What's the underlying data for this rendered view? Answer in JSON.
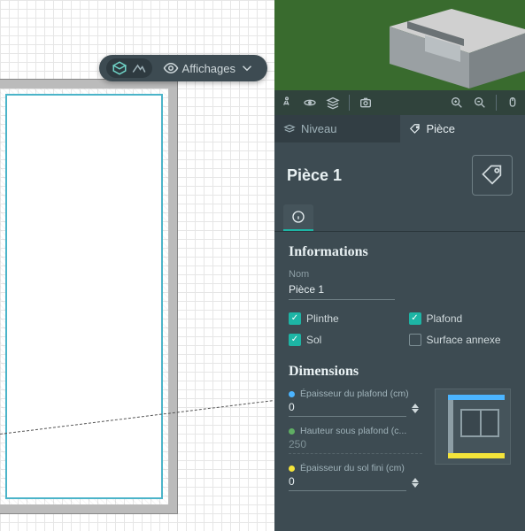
{
  "toolbar2d": {
    "affichages_label": "Affichages"
  },
  "inspector": {
    "tabs": {
      "level": "Niveau",
      "room": "Pièce"
    },
    "title": "Pièce 1",
    "sections": {
      "informations": {
        "heading": "Informations",
        "name_label": "Nom",
        "name_value": "Pièce 1",
        "checks": {
          "plinthe": "Plinthe",
          "plafond": "Plafond",
          "sol": "Sol",
          "surface_annexe": "Surface annexe"
        }
      },
      "dimensions": {
        "heading": "Dimensions",
        "ceiling_thickness": {
          "label": "Épaisseur du plafond (cm)",
          "value": "0",
          "color": "#4bb4ff"
        },
        "height_under_ceiling": {
          "label": "Hauteur sous plafond (c...",
          "value": "250",
          "color": "#5fae63"
        },
        "floor_thickness": {
          "label": "Épaisseur du sol fini (cm)",
          "value": "0",
          "color": "#f4e43a"
        }
      }
    }
  }
}
